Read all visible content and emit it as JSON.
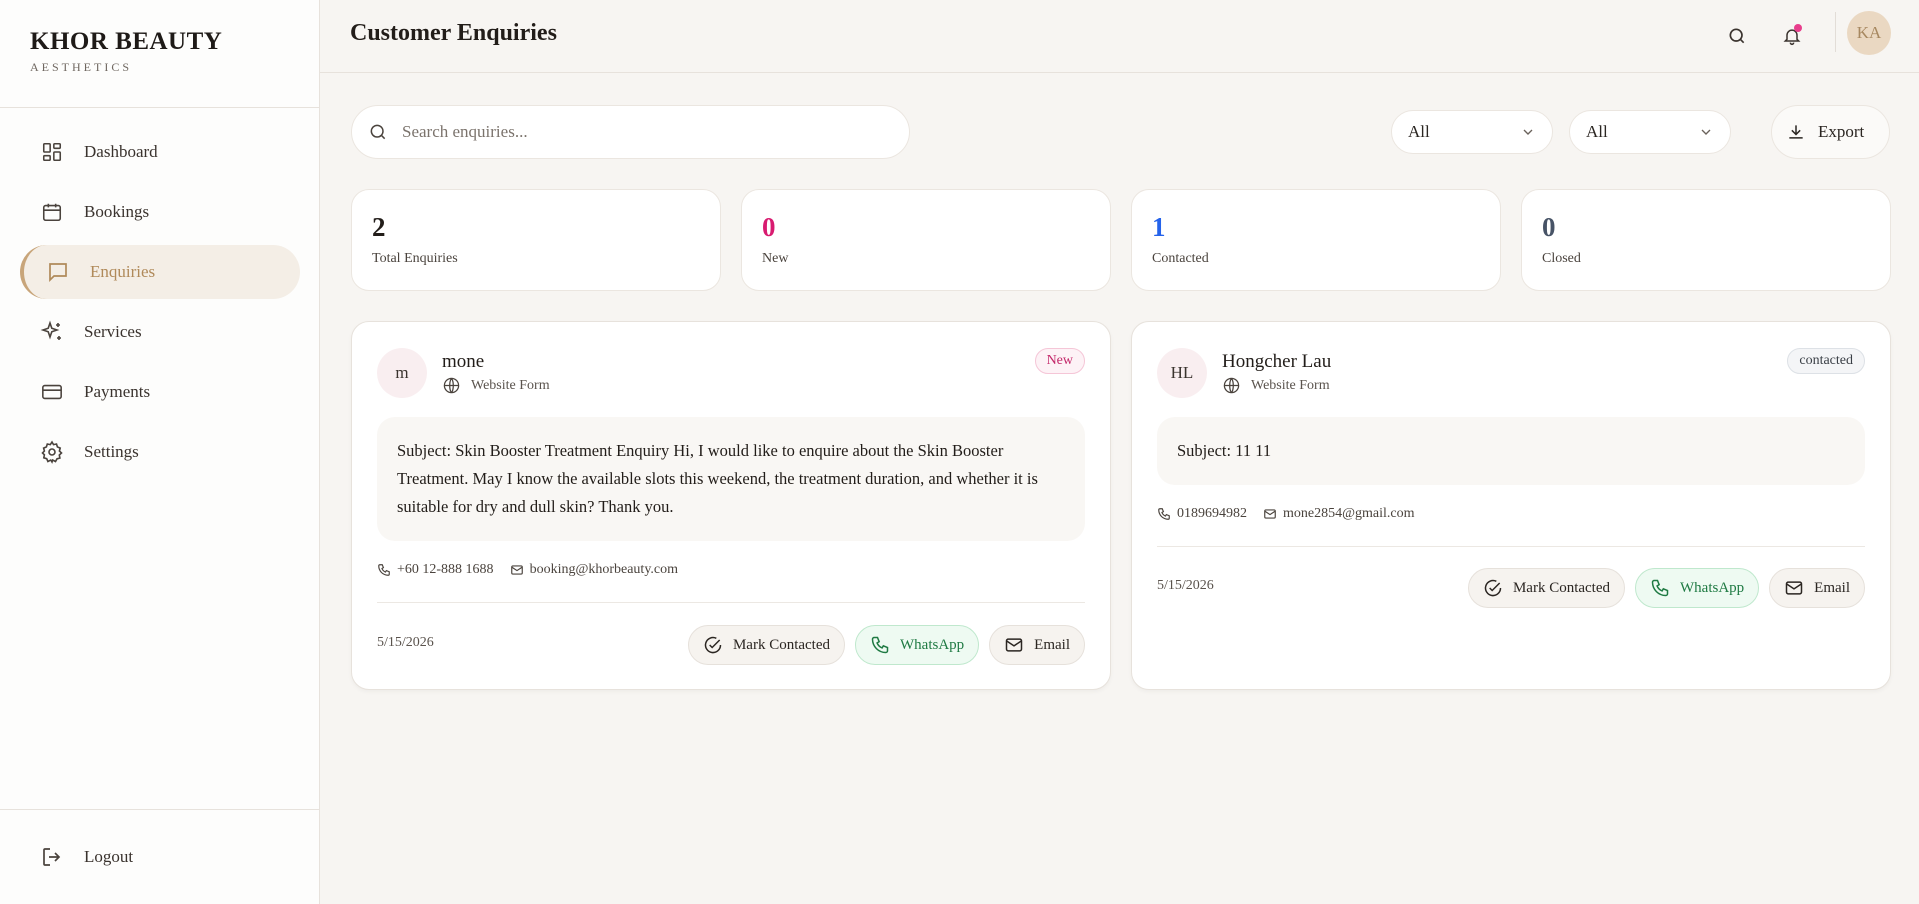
{
  "brand": {
    "name": "KHOR BEAUTY",
    "subtitle": "AESTHETICS"
  },
  "sidebar": {
    "items": [
      {
        "label": "Dashboard",
        "icon": "dashboard-icon"
      },
      {
        "label": "Bookings",
        "icon": "calendar-icon"
      },
      {
        "label": "Enquiries",
        "icon": "message-icon",
        "active": true
      },
      {
        "label": "Services",
        "icon": "sparkles-icon"
      },
      {
        "label": "Payments",
        "icon": "credit-card-icon"
      },
      {
        "label": "Settings",
        "icon": "gear-icon"
      }
    ],
    "logout": "Logout"
  },
  "header": {
    "title": "Customer Enquiries",
    "avatar_initials": "KA"
  },
  "toolbar": {
    "search_placeholder": "Search enquiries...",
    "filter_status": "All",
    "filter_source": "All",
    "export_label": "Export"
  },
  "stats": [
    {
      "value": "2",
      "label": "Total Enquiries",
      "color": "#221d19"
    },
    {
      "value": "0",
      "label": "New",
      "color": "#d81b70"
    },
    {
      "value": "1",
      "label": "Contacted",
      "color": "#2563eb"
    },
    {
      "value": "0",
      "label": "Closed",
      "color": "#475366"
    }
  ],
  "enquiries": [
    {
      "initials": "m",
      "name": "mone",
      "source": "Website Form",
      "status": "New",
      "message": "Subject: Skin Booster Treatment Enquiry Hi, I would like to enquire about the Skin Booster Treatment. May I know the available slots this weekend, the treatment duration, and whether it is suitable for dry and dull skin? Thank you.",
      "phone": "+60 12-888 1688",
      "email": "booking@khorbeauty.com",
      "date": "5/15/2026",
      "actions": {
        "mark": "Mark Contacted",
        "whatsapp": "WhatsApp",
        "email": "Email"
      }
    },
    {
      "initials": "HL",
      "name": "Hongcher Lau",
      "source": "Website Form",
      "status": "contacted",
      "message": "Subject: 11 11",
      "phone": "0189694982",
      "email": "mone2854@gmail.com",
      "date": "5/15/2026",
      "actions": {
        "mark": "Mark Contacted",
        "whatsapp": "WhatsApp",
        "email": "Email"
      }
    }
  ],
  "colors": {
    "accent": "#c8a57a",
    "notification": "#e83e8c",
    "whatsapp": "#1f7a43"
  }
}
